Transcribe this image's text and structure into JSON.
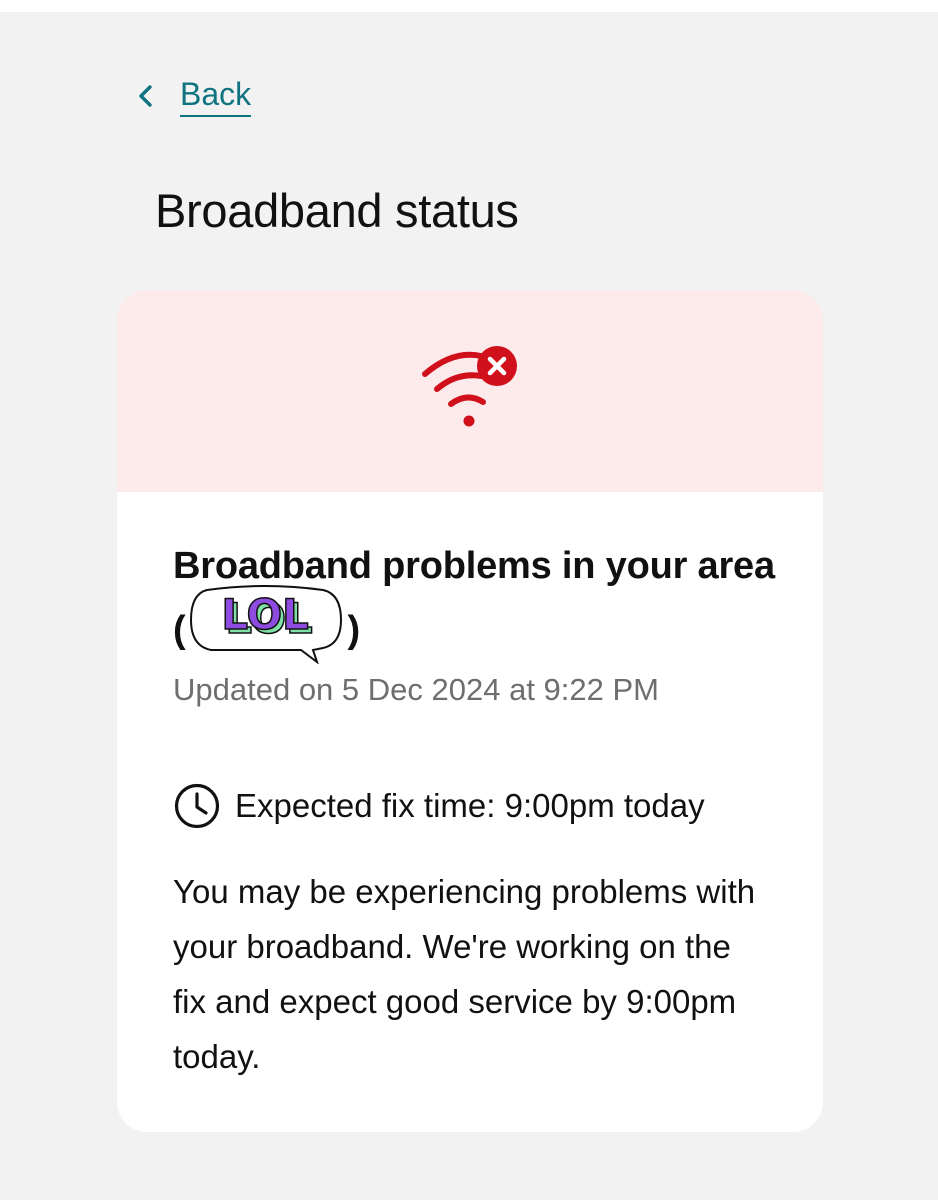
{
  "nav": {
    "back_label": "Back"
  },
  "page": {
    "title": "Broadband status"
  },
  "status": {
    "icon": "wifi-error-icon",
    "title_before": "Broadband problems in your area (",
    "title_after": ")",
    "sticker_text": "LOL",
    "updated": "Updated on 5 Dec 2024 at 9:22 PM",
    "fix_icon": "clock-icon",
    "fix_time": "Expected fix time: 9:00pm today",
    "description": "You may be experiencing problems with your broadband. We're working on the fix and expect good service by 9:00pm today."
  },
  "colors": {
    "accent": "#0f7480",
    "error": "#d0111b",
    "banner_bg": "#fdeaea",
    "page_bg": "#f2f2f2",
    "sticker_fill": "#8e4be0",
    "sticker_shadow": "#7fe0a8"
  }
}
